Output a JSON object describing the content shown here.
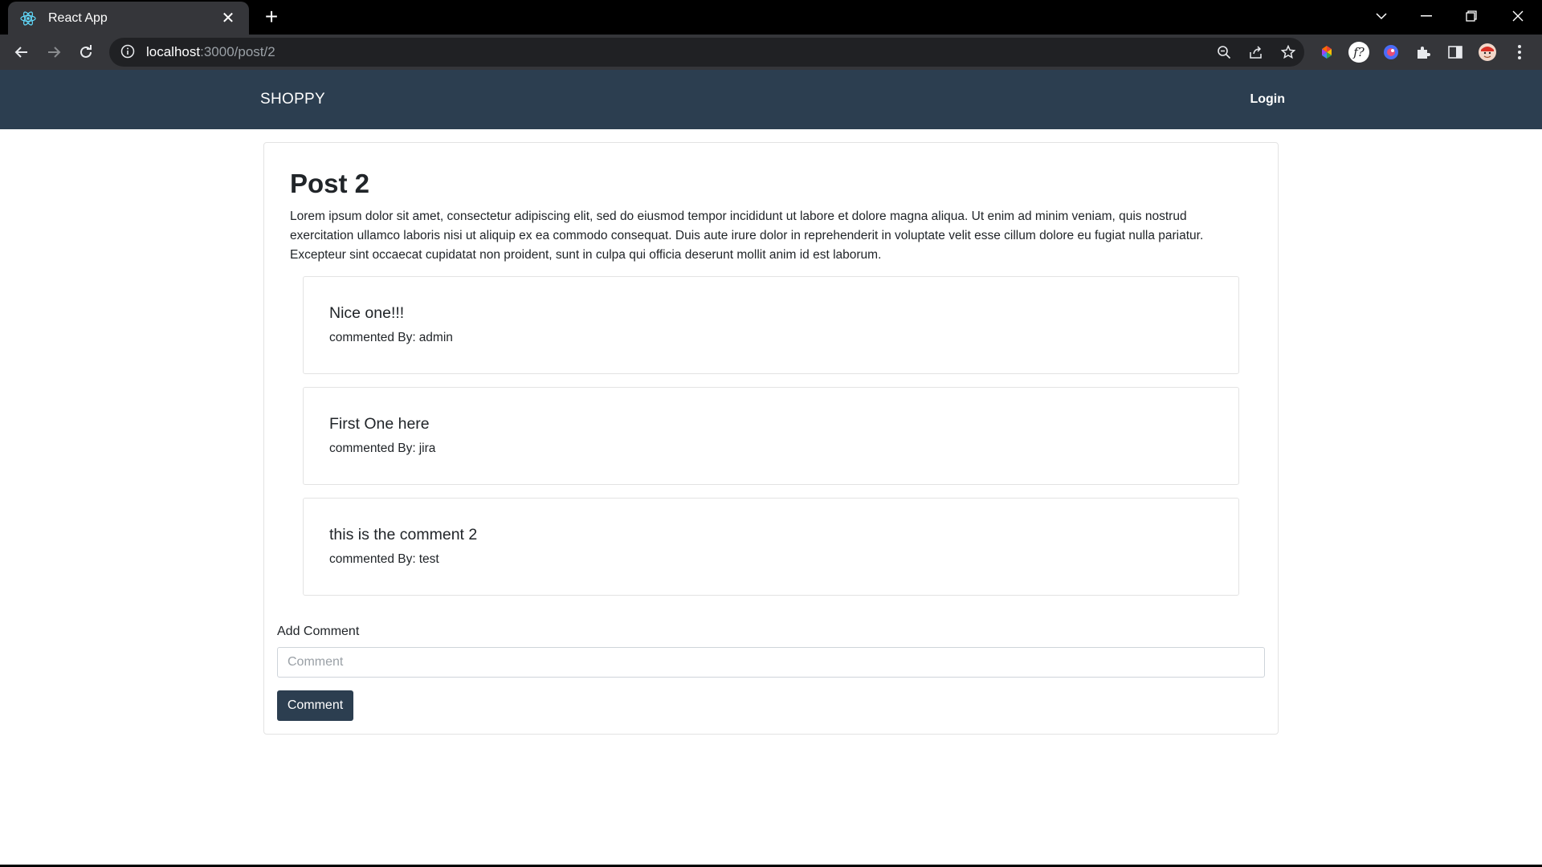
{
  "browser": {
    "tab_title": "React App",
    "url_host": "localhost",
    "url_path": ":3000/post/2",
    "accent": "#35363a"
  },
  "navbar": {
    "brand": "SHOPPY",
    "login": "Login",
    "background": "#2c3e50"
  },
  "post": {
    "title": "Post 2",
    "body": "Lorem ipsum dolor sit amet, consectetur adipiscing elit, sed do eiusmod tempor incididunt ut labore et dolore magna aliqua. Ut enim ad minim veniam, quis nostrud exercitation ullamco laboris nisi ut aliquip ex ea commodo consequat. Duis aute irure dolor in reprehenderit in voluptate velit esse cillum dolore eu fugiat nulla pariatur. Excepteur sint occaecat cupidatat non proident, sunt in culpa qui officia deserunt mollit anim id est laborum."
  },
  "comments": [
    {
      "text": "Nice one!!!",
      "by_label": "commented By:",
      "author": "admin"
    },
    {
      "text": "First One here",
      "by_label": "commented By:",
      "author": "jira"
    },
    {
      "text": "this is the comment 2",
      "by_label": "commented By:",
      "author": "test"
    }
  ],
  "form": {
    "label": "Add Comment",
    "placeholder": "Comment",
    "value": "",
    "button": "Comment"
  }
}
